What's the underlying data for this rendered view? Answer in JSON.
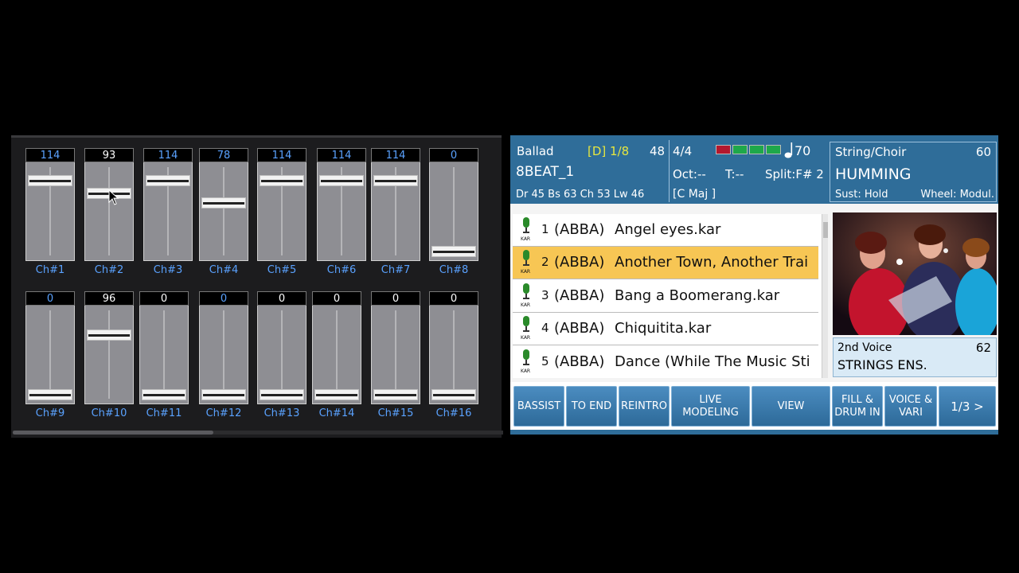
{
  "mixer": {
    "channels": [
      {
        "label": "Ch#1",
        "value": "114",
        "level": 0.89
      },
      {
        "label": "Ch#2",
        "value": "93",
        "level": 0.73,
        "selected": true
      },
      {
        "label": "Ch#3",
        "value": "114",
        "level": 0.89
      },
      {
        "label": "Ch#4",
        "value": "78",
        "level": 0.61
      },
      {
        "label": "Ch#5",
        "value": "114",
        "level": 0.89
      },
      {
        "label": "Ch#6",
        "value": "114",
        "level": 0.89
      },
      {
        "label": "Ch#7",
        "value": "114",
        "level": 0.89
      },
      {
        "label": "Ch#8",
        "value": "0",
        "level": 0
      },
      {
        "label": "Ch#9",
        "value": "0",
        "level": 0
      },
      {
        "label": "Ch#10",
        "value": "96",
        "level": 0.75,
        "selected": true
      },
      {
        "label": "Ch#11",
        "value": "0",
        "level": 0,
        "selected": true
      },
      {
        "label": "Ch#12",
        "value": "0",
        "level": 0
      },
      {
        "label": "Ch#13",
        "value": "0",
        "level": 0,
        "selected": true
      },
      {
        "label": "Ch#14",
        "value": "0",
        "level": 0,
        "selected": true
      },
      {
        "label": "Ch#15",
        "value": "0",
        "level": 0,
        "selected": true
      },
      {
        "label": "Ch#16",
        "value": "0",
        "level": 0,
        "selected": true
      }
    ]
  },
  "status": {
    "style_category": "Ballad",
    "variation": "[D] 1/8",
    "measure": "48",
    "time_sig": "4/4",
    "tempo": "70",
    "style_name": "8BEAT_1",
    "octave": "Oct:--",
    "transpose": "T:--",
    "split": "Split:F# 2",
    "parts": "Dr 45   Bs 63   Ch 53   Lw 46",
    "chord": "[C Maj          ]",
    "voice_category": "String/Choir",
    "voice_number": "60",
    "voice_name": "HUMMING",
    "sustain": "Sust: Hold",
    "wheel": "Wheel: Modul."
  },
  "songs": [
    {
      "num": "1",
      "artist": "(ABBA)",
      "title": "Angel eyes.kar",
      "mic": "KAR"
    },
    {
      "num": "2",
      "artist": "(ABBA)",
      "title": "Another Town, Another Trai",
      "mic": "KAR",
      "selected": true
    },
    {
      "num": "3",
      "artist": "(ABBA)",
      "title": "Bang a Boomerang.kar",
      "mic": "KAR"
    },
    {
      "num": "4",
      "artist": "(ABBA)",
      "title": "Chiquitita.kar",
      "mic": "KAR"
    },
    {
      "num": "5",
      "artist": "(ABBA)",
      "title": "Dance (While The Music Sti",
      "mic": "KAR"
    }
  ],
  "second_voice": {
    "label": "2nd Voice",
    "number": "62",
    "name": "STRINGS ENS."
  },
  "buttons": {
    "bassist": "BASSIST",
    "to_end": "TO END",
    "reintro": "REINTRO",
    "live_modeling_1": "LIVE",
    "live_modeling_2": "MODELING",
    "view": "VIEW",
    "fill_1": "FILL &",
    "fill_2": "DRUM IN",
    "voice_1": "VOICE &",
    "voice_2": "VARI",
    "page": "1/3 >"
  },
  "colors": {
    "accent": "#2f6d99",
    "highlight": "#f7c654",
    "channel_label": "#5aa2ff"
  }
}
